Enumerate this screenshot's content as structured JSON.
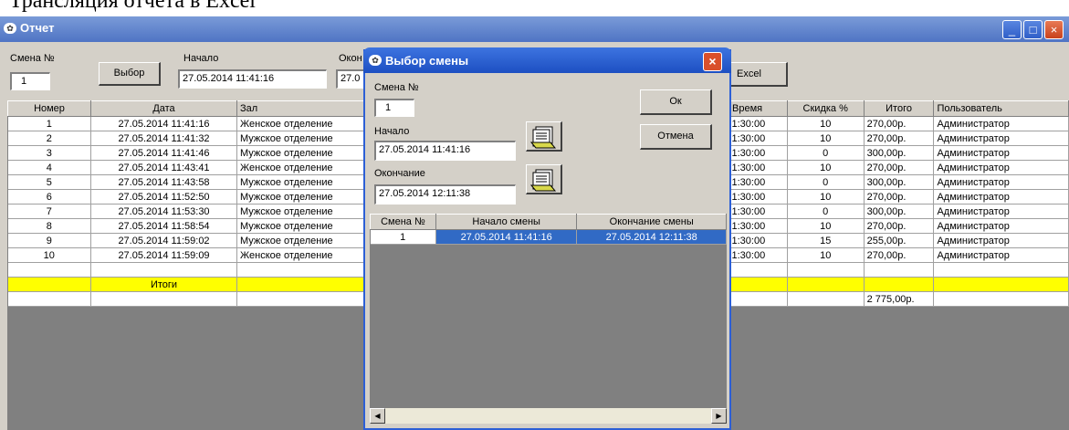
{
  "document": {
    "heading_fragment": "Трансляция отчета в Excel"
  },
  "window": {
    "title": "Отчет",
    "controls": {
      "minimize": "_",
      "maximize": "□",
      "close": "×"
    }
  },
  "toolbar": {
    "shift_label": "Смена №",
    "shift_value": "1",
    "select_button": "Выбор",
    "start_label": "Начало",
    "start_value": "27.05.2014 11:41:16",
    "end_label_partial": "Окон",
    "end_value_partial": "27.0",
    "excel_button_partial": "Excel"
  },
  "report_table": {
    "headers_left": [
      "Номер",
      "Дата",
      "Зал"
    ],
    "headers_right": [
      "Время",
      "Скидка %",
      "Итого",
      "Пользователь"
    ],
    "rows": [
      {
        "num": "1",
        "date": "27.05.2014 11:41:16",
        "hall": "Женское отделение",
        "time": "1:30:00",
        "discount": "10",
        "total": "270,00р.",
        "user": "Администратор"
      },
      {
        "num": "2",
        "date": "27.05.2014 11:41:32",
        "hall": "Мужское отделение",
        "time": "1:30:00",
        "discount": "10",
        "total": "270,00р.",
        "user": "Администратор"
      },
      {
        "num": "3",
        "date": "27.05.2014 11:41:46",
        "hall": "Мужское отделение",
        "time": "1:30:00",
        "discount": "0",
        "total": "300,00р.",
        "user": "Администратор"
      },
      {
        "num": "4",
        "date": "27.05.2014 11:43:41",
        "hall": "Женское отделение",
        "time": "1:30:00",
        "discount": "10",
        "total": "270,00р.",
        "user": "Администратор"
      },
      {
        "num": "5",
        "date": "27.05.2014 11:43:58",
        "hall": "Мужское отделение",
        "time": "1:30:00",
        "discount": "0",
        "total": "300,00р.",
        "user": "Администратор"
      },
      {
        "num": "6",
        "date": "27.05.2014 11:52:50",
        "hall": "Мужское отделение",
        "time": "1:30:00",
        "discount": "10",
        "total": "270,00р.",
        "user": "Администратор"
      },
      {
        "num": "7",
        "date": "27.05.2014 11:53:30",
        "hall": "Мужское отделение",
        "time": "1:30:00",
        "discount": "0",
        "total": "300,00р.",
        "user": "Администратор"
      },
      {
        "num": "8",
        "date": "27.05.2014 11:58:54",
        "hall": "Мужское отделение",
        "time": "1:30:00",
        "discount": "10",
        "total": "270,00р.",
        "user": "Администратор"
      },
      {
        "num": "9",
        "date": "27.05.2014 11:59:02",
        "hall": "Мужское отделение",
        "time": "1:30:00",
        "discount": "15",
        "total": "255,00р.",
        "user": "Администратор"
      },
      {
        "num": "10",
        "date": "27.05.2014 11:59:09",
        "hall": "Женское отделение",
        "time": "1:30:00",
        "discount": "10",
        "total": "270,00р.",
        "user": "Администратор"
      }
    ],
    "totals_label": "Итоги",
    "grand_total": "2 775,00р."
  },
  "dialog": {
    "title": "Выбор смены",
    "shift_label": "Смена №",
    "shift_value": "1",
    "start_label": "Начало",
    "start_value": "27.05.2014 11:41:16",
    "end_label": "Окончание",
    "end_value": "27.05.2014 12:11:38",
    "ok_button": "Ок",
    "cancel_button": "Отмена",
    "close": "×",
    "grid_headers": [
      "Смена №",
      "Начало смены",
      "Окончание смены"
    ],
    "grid_rows": [
      {
        "shift": "1",
        "start": "27.05.2014 11:41:16",
        "end": "27.05.2014 12:11:38"
      }
    ]
  },
  "colors": {
    "titlebar": "#4f74c4",
    "dialog_titlebar": "#1d4fc2",
    "selected_row": "#316ac5",
    "totals_row": "#ffff00"
  }
}
